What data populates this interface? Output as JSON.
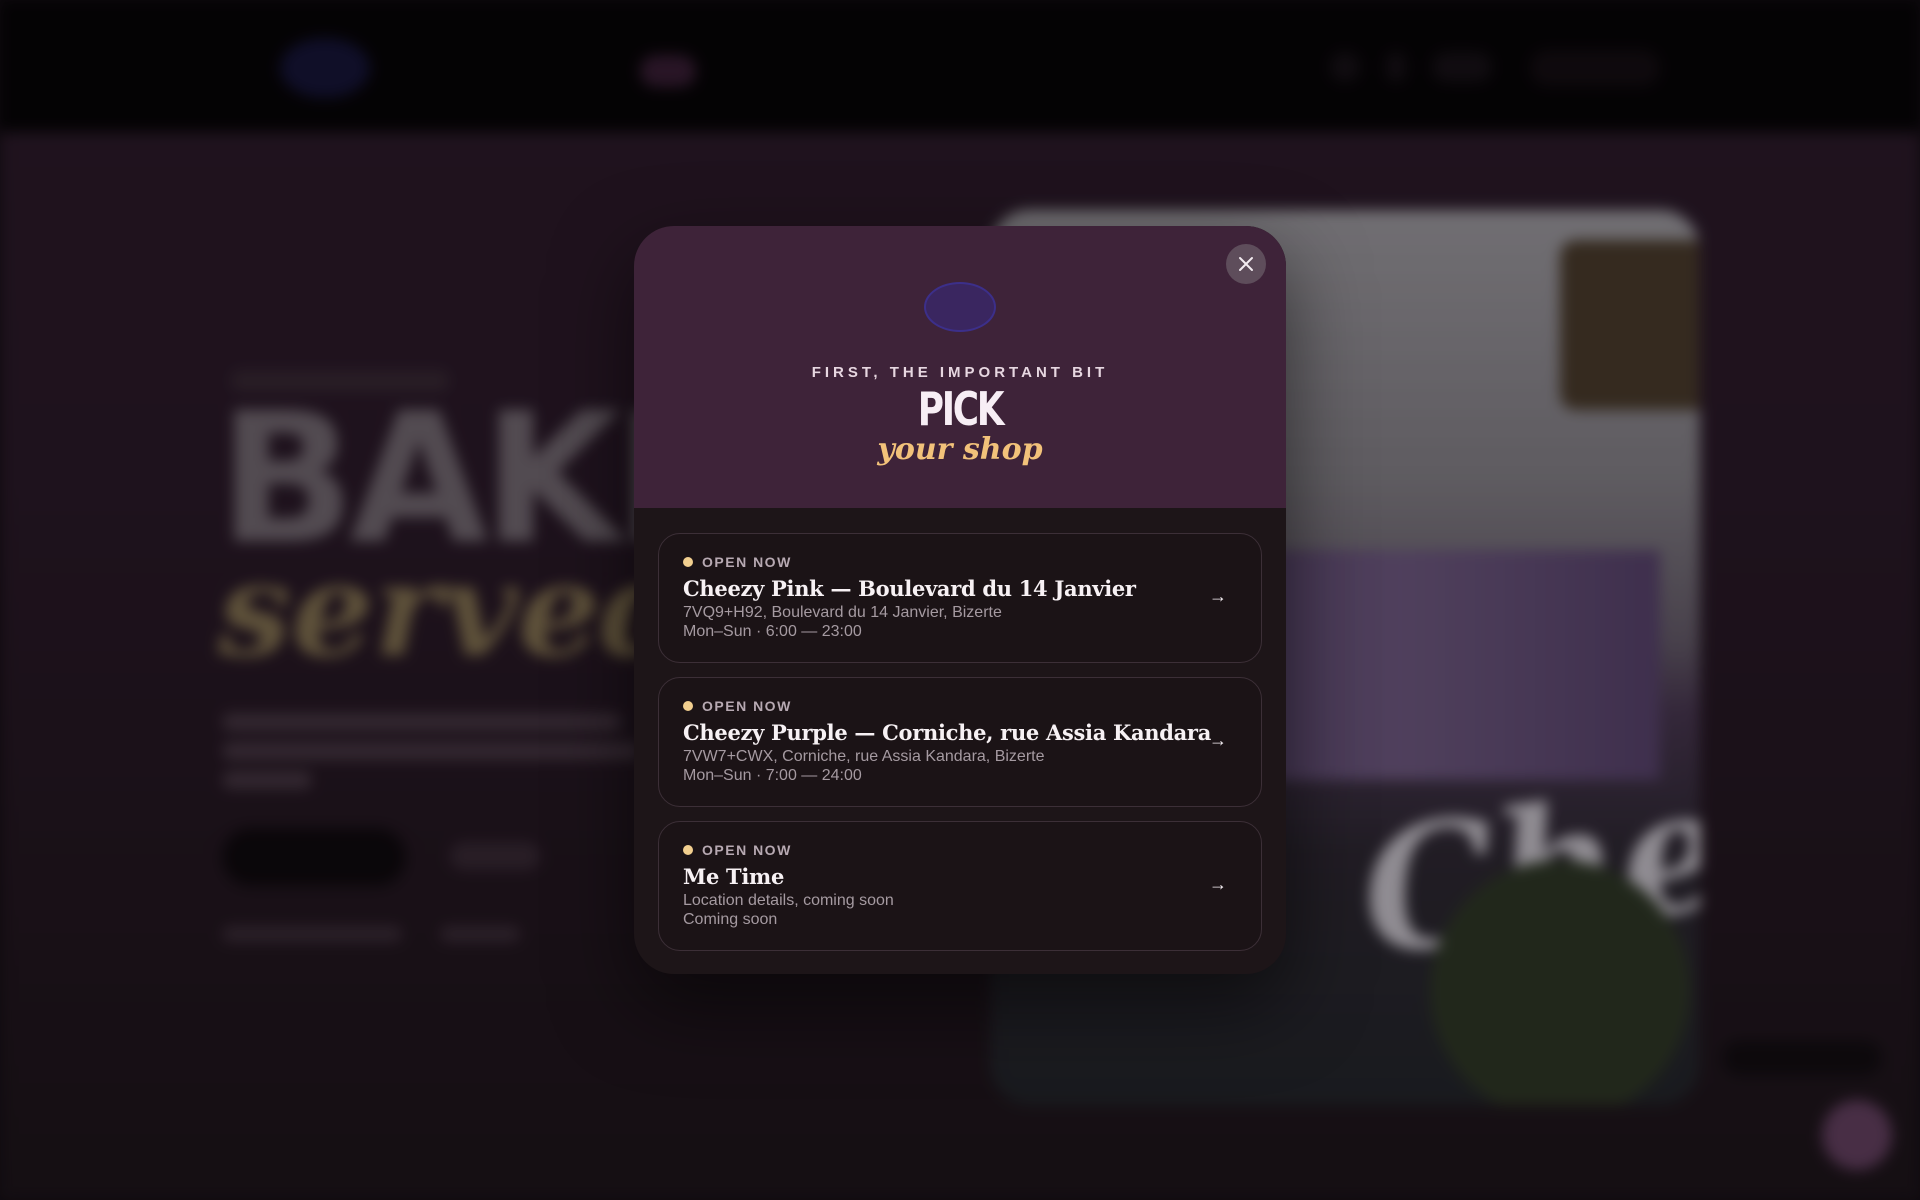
{
  "background": {
    "hero_line_1": "BAKED",
    "hero_line_2": "served b",
    "sign_text": "Cheezy"
  },
  "modal": {
    "close_icon": "close-icon",
    "kicker": "FIRST, THE IMPORTANT BIT",
    "title": "PICK",
    "subtitle": "your shop",
    "shops": [
      {
        "status": "OPEN NOW",
        "name": "Cheezy Pink — Boulevard du 14 Janvier",
        "address": "7VQ9+H92, Boulevard du 14 Janvier, Bizerte",
        "hours": "Mon–Sun · 6:00 — 23:00",
        "arrow": "→"
      },
      {
        "status": "OPEN NOW",
        "name": "Cheezy Purple — Corniche, rue Assia Kandara",
        "address": "7VW7+CWX, Corniche, rue Assia Kandara, Bizerte",
        "hours": "Mon–Sun · 7:00 — 24:00",
        "arrow": "→"
      },
      {
        "status": "OPEN NOW",
        "name": "Me Time",
        "address": "Location details, coming soon",
        "hours": "Coming soon",
        "arrow": "→"
      }
    ]
  },
  "colors": {
    "header_purple": "#3e2339",
    "accent_gold": "#f2c27a",
    "status_dot": "#f2cf8f",
    "card_bg": "#1b1316"
  }
}
